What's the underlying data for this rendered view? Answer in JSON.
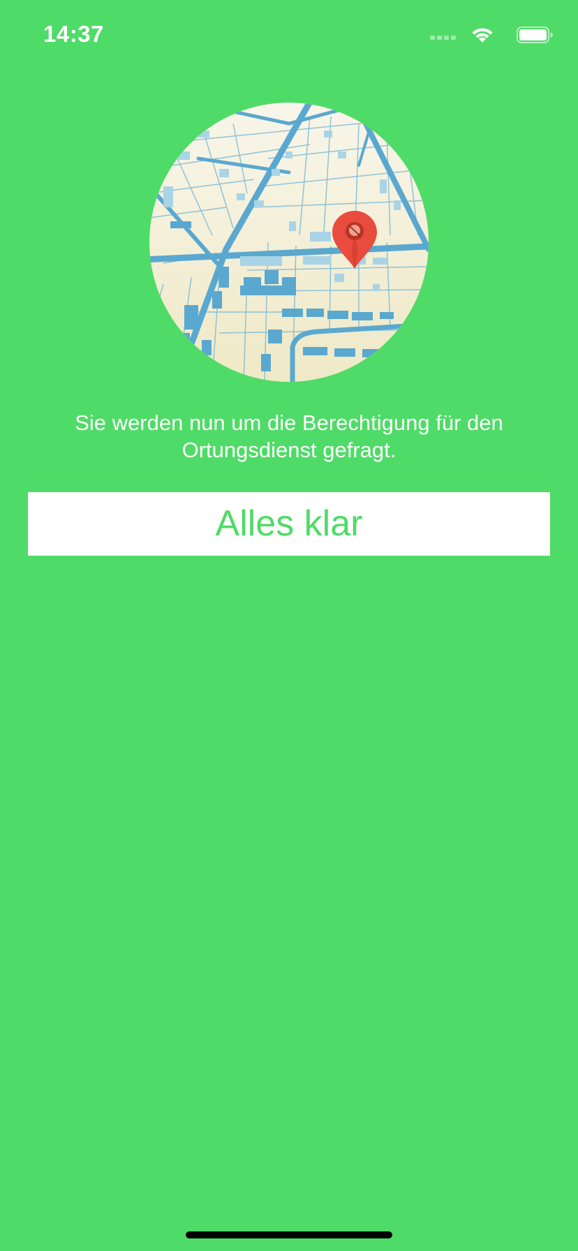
{
  "status_bar": {
    "time": "14:37",
    "icons": [
      "cellular-signal-icon",
      "wifi-icon",
      "battery-icon"
    ]
  },
  "illustration": {
    "name": "city-map-with-location-pin",
    "pin_color": "#E94B3C",
    "street_color": "#5AA8CF",
    "land_color": "#F3EED5"
  },
  "message": {
    "text": "Sie werden nun um die Berechtigung für den Ortungsdienst gefragt."
  },
  "button": {
    "label": "Alles klar"
  },
  "colors": {
    "background": "#4FDB67",
    "accent": "#4FDB67",
    "button_background": "#FFFFFF"
  }
}
